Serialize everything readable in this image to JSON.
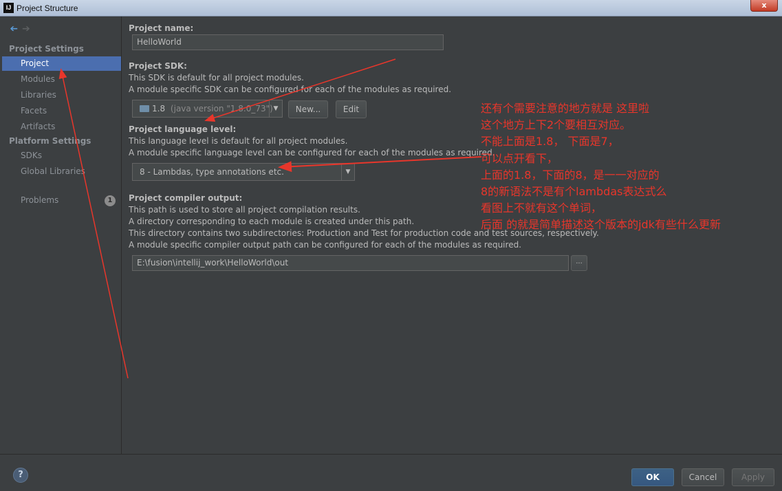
{
  "window": {
    "title": "Project Structure",
    "app_icon": "IJ",
    "close_label": "x"
  },
  "nav": {
    "back_icon": "➔",
    "forward_icon": "➔"
  },
  "sidebar": {
    "project_settings_header": "Project Settings",
    "platform_settings_header": "Platform Settings",
    "items": [
      {
        "label": "Project"
      },
      {
        "label": "Modules"
      },
      {
        "label": "Libraries"
      },
      {
        "label": "Facets"
      },
      {
        "label": "Artifacts"
      },
      {
        "label": "SDKs"
      },
      {
        "label": "Global Libraries"
      },
      {
        "label": "Problems",
        "badge": "1"
      }
    ]
  },
  "main": {
    "project_name": {
      "label": "Project name:",
      "value": "HelloWorld"
    },
    "sdk": {
      "label": "Project SDK:",
      "desc1": "This SDK is default for all project modules.",
      "desc2": "A module specific SDK can be configured for each of the modules as required.",
      "version": "1.8",
      "version_detail": "(java version \"1.8.0_73\")",
      "new_button": "New...",
      "edit_button": "Edit"
    },
    "language_level": {
      "label": "Project language level:",
      "desc1": "This language level is default for all project modules.",
      "desc2": "A module specific language level can be configured for each of the modules as required.",
      "value": "8 - Lambdas, type annotations etc."
    },
    "compiler_output": {
      "label": "Project compiler output:",
      "desc1": "This path is used to store all project compilation results.",
      "desc2": "A directory corresponding to each module is created under this path.",
      "desc3": "This directory contains two subdirectories: Production and Test for production code and test sources, respectively.",
      "desc4": "A module specific compiler output path can be configured for each of the modules as required.",
      "path": "E:\\fusion\\intellij_work\\HelloWorld\\out",
      "browse_label": "..."
    }
  },
  "annotation": {
    "lines": [
      "还有个需要注意的地方就是 这里啦",
      "这个地方上下2个要相互对应。",
      "不能上面是1.8，   下面是7，",
      "可以点开看下，",
      "上面的1.8，下面的8，是一一对应的",
      "8的新语法不是有个lambdas表达式么",
      "看图上不就有这个单词，",
      "后面 的就是简单描述这个版本的jdk有些什么更新"
    ],
    "color": "#e8362b"
  },
  "footer": {
    "help": "?",
    "ok": "OK",
    "cancel": "Cancel",
    "apply": "Apply"
  }
}
